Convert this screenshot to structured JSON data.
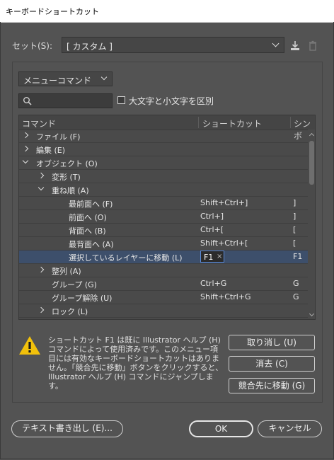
{
  "window": {
    "title": "キーボードショートカット"
  },
  "set": {
    "label": "セット(S):",
    "value": "[ カスタム ]"
  },
  "category": {
    "value": "メニューコマンド"
  },
  "search": {
    "placeholder": ""
  },
  "case_sensitive": {
    "label": "大文字と小文字を区別",
    "checked": false
  },
  "table": {
    "columns": [
      "コマンド",
      "ショートカット",
      "シンボ"
    ],
    "rows": [
      {
        "indent": 0,
        "expander": "right",
        "command": "ファイル (F)",
        "shortcut": "",
        "symbol": ""
      },
      {
        "indent": 0,
        "expander": "right",
        "command": "編集 (E)",
        "shortcut": "",
        "symbol": ""
      },
      {
        "indent": 0,
        "expander": "down",
        "command": "オブジェクト (O)",
        "shortcut": "",
        "symbol": ""
      },
      {
        "indent": 1,
        "expander": "right",
        "command": "変形 (T)",
        "shortcut": "",
        "symbol": ""
      },
      {
        "indent": 1,
        "expander": "down",
        "command": "重ね順 (A)",
        "shortcut": "",
        "symbol": ""
      },
      {
        "indent": 2,
        "expander": "",
        "command": "最前面へ (F)",
        "shortcut": "Shift+Ctrl+]",
        "symbol": "]"
      },
      {
        "indent": 2,
        "expander": "",
        "command": "前面へ (O)",
        "shortcut": "Ctrl+]",
        "symbol": "]"
      },
      {
        "indent": 2,
        "expander": "",
        "command": "背面へ (B)",
        "shortcut": "Ctrl+[",
        "symbol": "["
      },
      {
        "indent": 2,
        "expander": "",
        "command": "最背面へ (A)",
        "shortcut": "Shift+Ctrl+[",
        "symbol": "["
      },
      {
        "indent": 2,
        "expander": "",
        "command": "選択しているレイヤーに移動 (L)",
        "shortcut": "F1",
        "symbol": "F1",
        "selected": true
      },
      {
        "indent": 1,
        "expander": "right",
        "command": "整列 (A)",
        "shortcut": "",
        "symbol": ""
      },
      {
        "indent": 1,
        "expander": "",
        "command": "グループ (G)",
        "shortcut": "Ctrl+G",
        "symbol": "G"
      },
      {
        "indent": 1,
        "expander": "",
        "command": "グループ解除 (U)",
        "shortcut": "Shift+Ctrl+G",
        "symbol": "G"
      },
      {
        "indent": 1,
        "expander": "right",
        "command": "ロック (L)",
        "shortcut": "",
        "symbol": ""
      }
    ],
    "edit_clear_glyph": "×"
  },
  "warning": {
    "text": "ショートカット F1 は既に Illustrator ヘルプ (H) コマンドによって使用済みです。このメニュー項目には有効なキーボードショートカットはありません。「競合先に移動」ボタンをクリックすると、Illustrator ヘルプ (H) コマンドにジャンプします。"
  },
  "buttons": {
    "undo": "取り消し (U)",
    "clear": "消去 (C)",
    "goto_conflict": "競合先に移動 (G)",
    "export_text": "テキスト書き出し (E)...",
    "ok": "OK",
    "cancel": "キャンセル"
  }
}
